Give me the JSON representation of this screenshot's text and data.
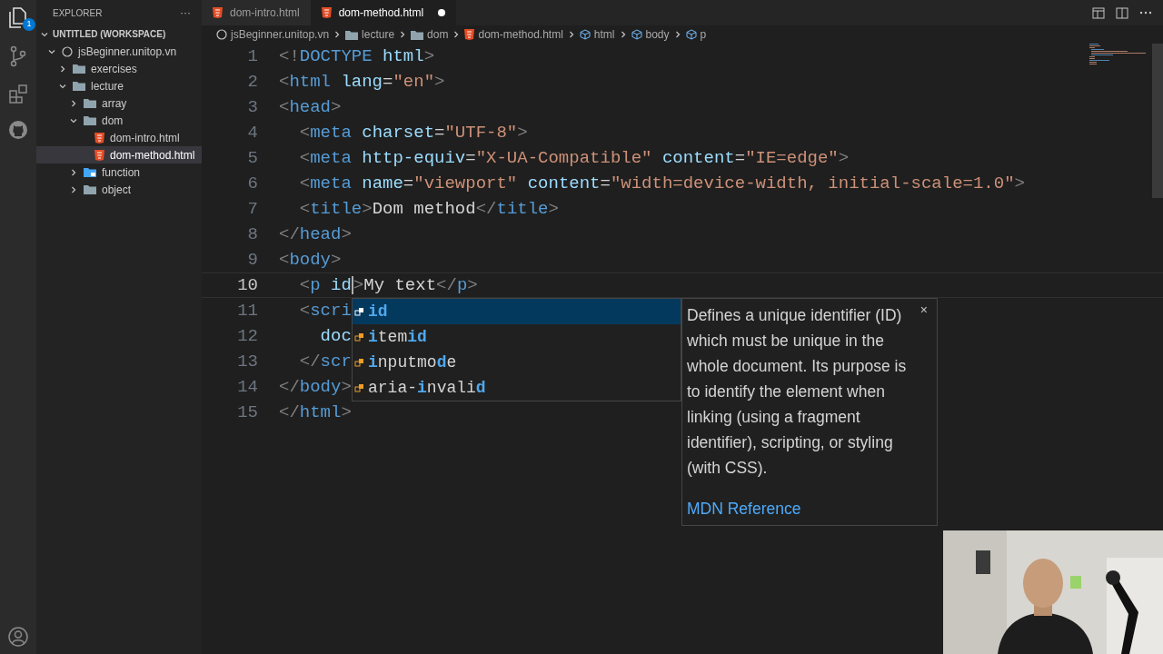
{
  "sidebar": {
    "title": "EXPLORER",
    "more": "···",
    "workspace": {
      "label": "UNTITLED (WORKSPACE)",
      "expanded": true,
      "children": [
        {
          "label": "jsBeginner.unitop.vn",
          "kind": "root",
          "expanded": true,
          "selected": false,
          "children": [
            {
              "label": "exercises",
              "kind": "folder",
              "expanded": false,
              "selected": false
            },
            {
              "label": "lecture",
              "kind": "folder",
              "expanded": true,
              "selected": false,
              "children": [
                {
                  "label": "array",
                  "kind": "folder",
                  "expanded": false,
                  "selected": false
                },
                {
                  "label": "dom",
                  "kind": "folder",
                  "expanded": true,
                  "selected": false,
                  "children": [
                    {
                      "label": "dom-intro.html",
                      "kind": "html",
                      "selected": false
                    },
                    {
                      "label": "dom-method.html",
                      "kind": "html",
                      "selected": true
                    }
                  ]
                },
                {
                  "label": "function",
                  "kind": "special-folder",
                  "expanded": false,
                  "selected": false
                },
                {
                  "label": "object",
                  "kind": "folder",
                  "expanded": false,
                  "selected": false
                }
              ]
            }
          ]
        }
      ]
    }
  },
  "activity_bar": {
    "badge": "1"
  },
  "tabs": [
    {
      "label": "dom-intro.html",
      "selected": false,
      "dirty": false
    },
    {
      "label": "dom-method.html",
      "selected": true,
      "dirty": true
    }
  ],
  "breadcrumb": [
    {
      "label": "jsBeginner.unitop.vn",
      "kind": "root"
    },
    {
      "label": "lecture",
      "kind": "folder"
    },
    {
      "label": "dom",
      "kind": "folder"
    },
    {
      "label": "dom-method.html",
      "kind": "html"
    },
    {
      "label": "html",
      "kind": "element"
    },
    {
      "label": "body",
      "kind": "element"
    },
    {
      "label": "p",
      "kind": "element"
    }
  ],
  "editor": {
    "lines": [
      {
        "n": "1",
        "current": false,
        "tokens": [
          {
            "kind": "punct",
            "t": "<!"
          },
          {
            "kind": "tag",
            "t": "DOCTYPE"
          },
          {
            "kind": "attr",
            "t": " html"
          },
          {
            "kind": "punct",
            "t": ">"
          }
        ]
      },
      {
        "n": "2",
        "current": false,
        "tokens": [
          {
            "kind": "punct",
            "t": "<"
          },
          {
            "kind": "tag",
            "t": "html"
          },
          {
            "kind": "attr",
            "t": " lang"
          },
          {
            "kind": "text",
            "t": "="
          },
          {
            "kind": "str",
            "t": "\"en\""
          },
          {
            "kind": "punct",
            "t": ">"
          }
        ]
      },
      {
        "n": "3",
        "current": false,
        "tokens": [
          {
            "kind": "punct",
            "t": "<"
          },
          {
            "kind": "tag",
            "t": "head"
          },
          {
            "kind": "punct",
            "t": ">"
          }
        ]
      },
      {
        "n": "4",
        "current": false,
        "tokens": [
          {
            "kind": "punct",
            "t": "  <"
          },
          {
            "kind": "tag",
            "t": "meta"
          },
          {
            "kind": "attr",
            "t": " charset"
          },
          {
            "kind": "text",
            "t": "="
          },
          {
            "kind": "str",
            "t": "\"UTF-8\""
          },
          {
            "kind": "punct",
            "t": ">"
          }
        ]
      },
      {
        "n": "5",
        "current": false,
        "tokens": [
          {
            "kind": "punct",
            "t": "  <"
          },
          {
            "kind": "tag",
            "t": "meta"
          },
          {
            "kind": "attr",
            "t": " http-equiv"
          },
          {
            "kind": "text",
            "t": "="
          },
          {
            "kind": "str",
            "t": "\"X-UA-Compatible\""
          },
          {
            "kind": "attr",
            "t": " content"
          },
          {
            "kind": "text",
            "t": "="
          },
          {
            "kind": "str",
            "t": "\"IE=edge\""
          },
          {
            "kind": "punct",
            "t": ">"
          }
        ]
      },
      {
        "n": "6",
        "current": false,
        "tokens": [
          {
            "kind": "punct",
            "t": "  <"
          },
          {
            "kind": "tag",
            "t": "meta"
          },
          {
            "kind": "attr",
            "t": " name"
          },
          {
            "kind": "text",
            "t": "="
          },
          {
            "kind": "str",
            "t": "\"viewport\""
          },
          {
            "kind": "attr",
            "t": " content"
          },
          {
            "kind": "text",
            "t": "="
          },
          {
            "kind": "str",
            "t": "\"width=device-width, initial-scale=1.0\""
          },
          {
            "kind": "punct",
            "t": ">"
          }
        ]
      },
      {
        "n": "7",
        "current": false,
        "tokens": [
          {
            "kind": "punct",
            "t": "  <"
          },
          {
            "kind": "tag",
            "t": "title"
          },
          {
            "kind": "punct",
            "t": ">"
          },
          {
            "kind": "text",
            "t": "Dom method"
          },
          {
            "kind": "punct",
            "t": "</"
          },
          {
            "kind": "tag",
            "t": "title"
          },
          {
            "kind": "punct",
            "t": ">"
          }
        ]
      },
      {
        "n": "8",
        "current": false,
        "tokens": [
          {
            "kind": "punct",
            "t": "</"
          },
          {
            "kind": "tag",
            "t": "head"
          },
          {
            "kind": "punct",
            "t": ">"
          }
        ]
      },
      {
        "n": "9",
        "current": false,
        "tokens": [
          {
            "kind": "punct",
            "t": "<"
          },
          {
            "kind": "tag",
            "t": "body"
          },
          {
            "kind": "punct",
            "t": ">"
          }
        ]
      },
      {
        "n": "10",
        "current": true,
        "tokens": [
          {
            "kind": "punct",
            "t": "  <"
          },
          {
            "kind": "tag",
            "t": "p"
          },
          {
            "kind": "attr",
            "t": " id",
            "caret_after": true
          },
          {
            "kind": "punct",
            "t": ">"
          },
          {
            "kind": "text",
            "t": "My text"
          },
          {
            "kind": "punct",
            "t": "</"
          },
          {
            "kind": "tag",
            "t": "p"
          },
          {
            "kind": "punct",
            "t": ">"
          }
        ]
      },
      {
        "n": "11",
        "current": false,
        "tokens": [
          {
            "kind": "punct",
            "t": "  <"
          },
          {
            "kind": "tag",
            "t": "scri"
          }
        ]
      },
      {
        "n": "12",
        "current": false,
        "tokens": [
          {
            "kind": "attr",
            "t": "    doc"
          }
        ]
      },
      {
        "n": "13",
        "current": false,
        "tokens": [
          {
            "kind": "punct",
            "t": "  </"
          },
          {
            "kind": "tag",
            "t": "scr"
          }
        ]
      },
      {
        "n": "14",
        "current": false,
        "tokens": [
          {
            "kind": "punct",
            "t": "</"
          },
          {
            "kind": "tag",
            "t": "body"
          },
          {
            "kind": "punct",
            "t": ">"
          }
        ]
      },
      {
        "n": "15",
        "current": false,
        "tokens": [
          {
            "kind": "punct",
            "t": "</"
          },
          {
            "kind": "tag",
            "t": "html"
          },
          {
            "kind": "punct",
            "t": ">"
          }
        ]
      }
    ]
  },
  "suggest": {
    "items": [
      {
        "selected": true,
        "parts": [
          {
            "t": "id",
            "kind": "match"
          }
        ]
      },
      {
        "selected": false,
        "parts": [
          {
            "t": "i",
            "kind": "match"
          },
          {
            "t": "tem",
            "kind": "plain"
          },
          {
            "t": "id",
            "kind": "match"
          }
        ]
      },
      {
        "selected": false,
        "parts": [
          {
            "t": "i",
            "kind": "match"
          },
          {
            "t": "nputmo",
            "kind": "plain"
          },
          {
            "t": "d",
            "kind": "match"
          },
          {
            "t": "e",
            "kind": "plain"
          }
        ]
      },
      {
        "selected": false,
        "parts": [
          {
            "t": "aria-",
            "kind": "plain"
          },
          {
            "t": "i",
            "kind": "match"
          },
          {
            "t": "nvali",
            "kind": "plain"
          },
          {
            "t": "d",
            "kind": "match"
          }
        ]
      }
    ],
    "doc": {
      "close": "×",
      "text": "Defines a unique identifier (ID) which must be unique in the whole document. Its purpose is to identify the element when linking (using a fragment identifier), scripting, or styling (with CSS).",
      "link": "MDN Reference"
    }
  }
}
